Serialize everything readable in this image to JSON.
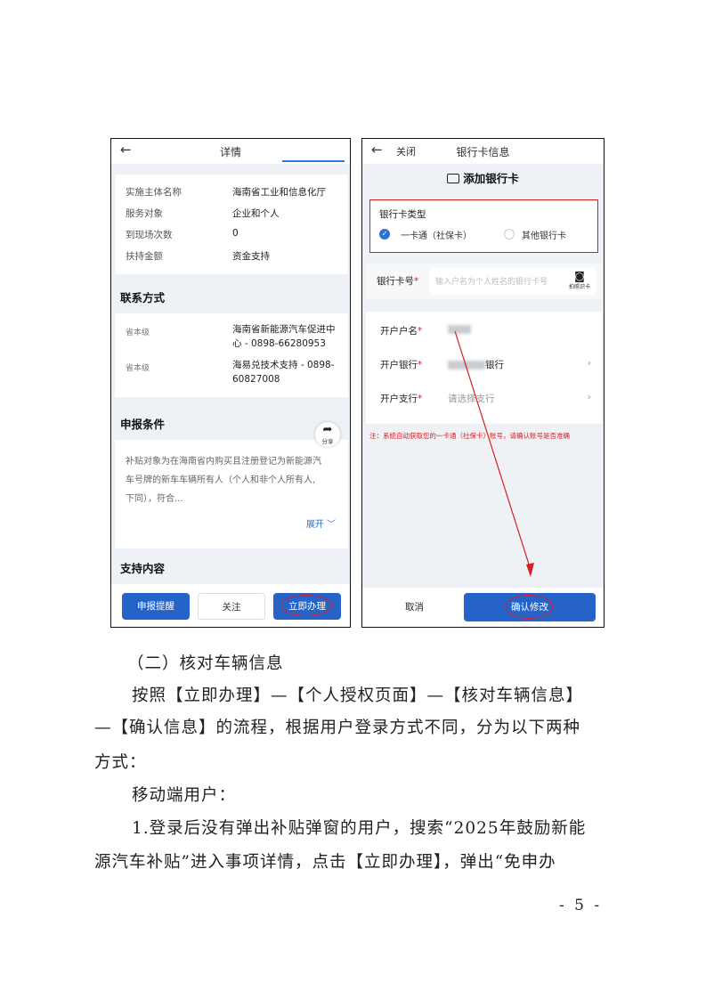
{
  "left_phone": {
    "header_title": "详情",
    "info_rows": [
      {
        "key": "实施主体名称",
        "value": "海南省工业和信息化厅"
      },
      {
        "key": "服务对象",
        "value": "企业和个人"
      },
      {
        "key": "到现场次数",
        "value": "0"
      },
      {
        "key": "扶持金额",
        "value": "资金支持"
      }
    ],
    "contact_title": "联系方式",
    "contacts": [
      {
        "level": "省本级",
        "line1": "海南省新能源汽车促进中",
        "line2": "心 - 0898-66280953"
      },
      {
        "level": "省本级",
        "line1": "海易兑技术支持 - 0898-",
        "line2": "60827008"
      }
    ],
    "condition_title": "申报条件",
    "share_label": "分享",
    "condition_lines": [
      "补贴对象为在海南省内购买且注册登记为新能源汽",
      "车号牌的新车车辆所有人（个人和非个人所有人,",
      "下同），符合..."
    ],
    "expand_label": "展开",
    "support_title": "支持内容",
    "buttons": {
      "remind": "申报提醒",
      "follow": "关注",
      "apply": "立即办理"
    }
  },
  "right_phone": {
    "close_label": "关闭",
    "header_title": "银行卡信息",
    "add_title": "添加银行卡",
    "card_type_label": "银行卡类型",
    "card_type_options": [
      {
        "label": "一卡通（社保卡）",
        "selected": true
      },
      {
        "label": "其他银行卡",
        "selected": false
      }
    ],
    "card_no_label": "银行卡号",
    "card_no_placeholder": "输入户名为个人姓名的银行卡号",
    "camera_label": "拍照识卡",
    "holder_label": "开户户名",
    "bank_label": "开户银行",
    "bank_value_suffix": "银行",
    "branch_label": "开户支行",
    "branch_placeholder": "请选择支行",
    "note": "注：系统自动获取您的一卡通（社保卡）账号，请确认账号是否准确",
    "cancel_label": "取消",
    "confirm_label": "确认修改"
  },
  "colors": {
    "primary_blue": "#2563c9",
    "annotation_red": "#d62020"
  },
  "document": {
    "section_heading": "（二）核对车辆信息",
    "para1_line1": "按照【立即办理】—【个人授权页面】—【核对车辆信息】",
    "para1_line2": "—【确认信息】的流程，根据用户登录方式不同，分为以下两种",
    "para1_line3": "方式：",
    "mobile_heading": "移动端用户：",
    "para2_line1": "1.登录后没有弹出补贴弹窗的用户，搜索“2025年鼓励新能",
    "para2_line2": "源汽车补贴”进入事项详情，点击【立即办理】，弹出“免申办",
    "page_number": "- 5 -"
  }
}
